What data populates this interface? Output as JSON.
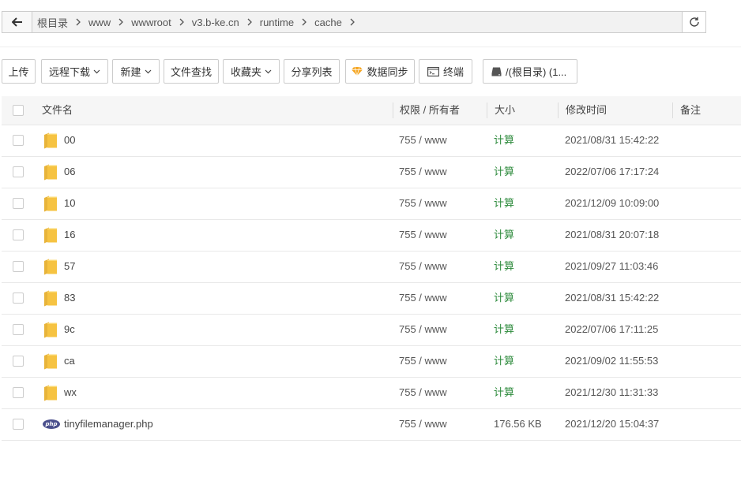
{
  "address": {
    "crumbs": [
      "根目录",
      "www",
      "wwwroot",
      "v3.b-ke.cn",
      "runtime",
      "cache"
    ]
  },
  "toolbar": {
    "upload": "上传",
    "remote_download": "远程下载",
    "new": "新建",
    "file_search": "文件查找",
    "favorites": "收藏夹",
    "share_list": "分享列表",
    "data_sync": "数据同步",
    "terminal": "终端",
    "disk": "/(根目录) (1..."
  },
  "table": {
    "headers": {
      "name": "文件名",
      "perm": "权限 / 所有者",
      "size": "大小",
      "mtime": "修改时间",
      "note": "备注"
    },
    "rows": [
      {
        "name": "00",
        "perm": "755 / www",
        "size": "计算",
        "mtime": "2021/08/31 15:42:22",
        "type": "folder"
      },
      {
        "name": "06",
        "perm": "755 / www",
        "size": "计算",
        "mtime": "2022/07/06 17:17:24",
        "type": "folder"
      },
      {
        "name": "10",
        "perm": "755 / www",
        "size": "计算",
        "mtime": "2021/12/09 10:09:00",
        "type": "folder"
      },
      {
        "name": "16",
        "perm": "755 / www",
        "size": "计算",
        "mtime": "2021/08/31 20:07:18",
        "type": "folder"
      },
      {
        "name": "57",
        "perm": "755 / www",
        "size": "计算",
        "mtime": "2021/09/27 11:03:46",
        "type": "folder"
      },
      {
        "name": "83",
        "perm": "755 / www",
        "size": "计算",
        "mtime": "2021/08/31 15:42:22",
        "type": "folder"
      },
      {
        "name": "9c",
        "perm": "755 / www",
        "size": "计算",
        "mtime": "2022/07/06 17:11:25",
        "type": "folder"
      },
      {
        "name": "ca",
        "perm": "755 / www",
        "size": "计算",
        "mtime": "2021/09/02 11:55:53",
        "type": "folder"
      },
      {
        "name": "wx",
        "perm": "755 / www",
        "size": "计算",
        "mtime": "2021/12/30 11:31:33",
        "type": "folder"
      },
      {
        "name": "tinyfilemanager.php",
        "perm": "755 / www",
        "size": "176.56 KB",
        "mtime": "2021/12/20 15:04:37",
        "type": "php"
      }
    ]
  },
  "icons": {
    "php_label": "php"
  },
  "colors": {
    "calc": "#2e8b3d",
    "folder": "#f6c342",
    "php": "#4a4f8c"
  }
}
